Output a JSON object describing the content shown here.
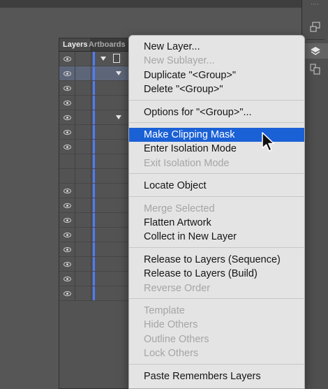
{
  "layers_panel": {
    "tabs": [
      "Layers",
      "Artboards"
    ],
    "rows": [
      {
        "eye": true,
        "selected": false
      },
      {
        "eye": true,
        "selected": true
      },
      {
        "eye": true,
        "selected": false
      },
      {
        "eye": true,
        "selected": false
      },
      {
        "eye": true,
        "selected": false
      },
      {
        "eye": true,
        "selected": false
      },
      {
        "eye": true,
        "selected": false
      },
      {
        "eye": false,
        "selected": false
      },
      {
        "eye": false,
        "selected": false
      },
      {
        "eye": true,
        "selected": false
      },
      {
        "eye": true,
        "selected": false
      },
      {
        "eye": true,
        "selected": false
      },
      {
        "eye": true,
        "selected": false
      },
      {
        "eye": true,
        "selected": false
      },
      {
        "eye": true,
        "selected": false
      },
      {
        "eye": true,
        "selected": false
      },
      {
        "eye": true,
        "selected": false
      }
    ]
  },
  "context_menu": {
    "groups": [
      [
        {
          "label": "New Layer...",
          "enabled": true
        },
        {
          "label": "New Sublayer...",
          "enabled": false
        },
        {
          "label": "Duplicate \"<Group>\"",
          "enabled": true
        },
        {
          "label": "Delete \"<Group>\"",
          "enabled": true
        }
      ],
      [
        {
          "label": "Options for \"<Group>\"...",
          "enabled": true
        }
      ],
      [
        {
          "label": "Make Clipping Mask",
          "enabled": true,
          "highlighted": true
        },
        {
          "label": "Enter Isolation Mode",
          "enabled": true
        },
        {
          "label": "Exit Isolation Mode",
          "enabled": false
        }
      ],
      [
        {
          "label": "Locate Object",
          "enabled": true
        }
      ],
      [
        {
          "label": "Merge Selected",
          "enabled": false
        },
        {
          "label": "Flatten Artwork",
          "enabled": true
        },
        {
          "label": "Collect in New Layer",
          "enabled": true
        }
      ],
      [
        {
          "label": "Release to Layers (Sequence)",
          "enabled": true
        },
        {
          "label": "Release to Layers (Build)",
          "enabled": true
        },
        {
          "label": "Reverse Order",
          "enabled": false
        }
      ],
      [
        {
          "label": "Template",
          "enabled": false
        },
        {
          "label": "Hide Others",
          "enabled": false
        },
        {
          "label": "Outline Others",
          "enabled": false
        },
        {
          "label": "Lock Others",
          "enabled": false
        }
      ],
      [
        {
          "label": "Paste Remembers Layers",
          "enabled": true
        }
      ]
    ]
  },
  "colors": {
    "highlight": "#1b61d6",
    "layer_color": "#4d7cff",
    "selected_row": "#5d6679"
  },
  "icons": [
    "artboard-navigator-icon",
    "layers-icon",
    "artboards-icon"
  ]
}
